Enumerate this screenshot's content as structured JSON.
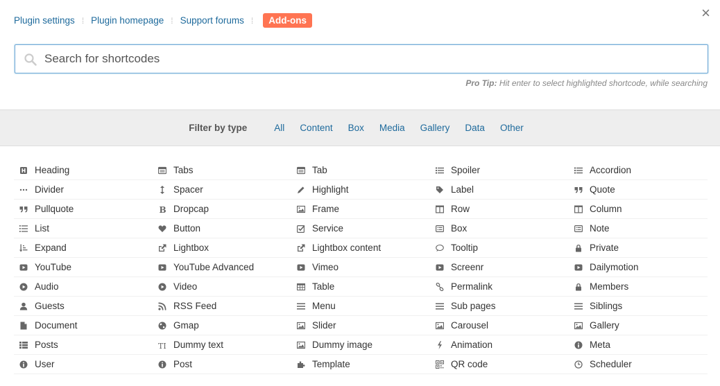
{
  "header": {
    "links": [
      "Plugin settings",
      "Plugin homepage",
      "Support forums"
    ],
    "addons_label": "Add-ons",
    "close_glyph": "×"
  },
  "search": {
    "placeholder": "Search for shortcodes",
    "value": ""
  },
  "protip": {
    "label": "Pro Tip:",
    "text": " Hit enter to select highlighted shortcode, while searching"
  },
  "filter": {
    "label": "Filter by type",
    "types": [
      "All",
      "Content",
      "Box",
      "Media",
      "Gallery",
      "Data",
      "Other"
    ]
  },
  "shortcodes": [
    {
      "label": "Heading",
      "icon": "heading-icon"
    },
    {
      "label": "Tabs",
      "icon": "tabs-icon"
    },
    {
      "label": "Tab",
      "icon": "tab-icon"
    },
    {
      "label": "Spoiler",
      "icon": "list-icon"
    },
    {
      "label": "Accordion",
      "icon": "list-icon"
    },
    {
      "label": "Divider",
      "icon": "ellipsis-icon"
    },
    {
      "label": "Spacer",
      "icon": "arrows-v-icon"
    },
    {
      "label": "Highlight",
      "icon": "pencil-icon"
    },
    {
      "label": "Label",
      "icon": "tag-icon"
    },
    {
      "label": "Quote",
      "icon": "quote-icon"
    },
    {
      "label": "Pullquote",
      "icon": "quote-icon"
    },
    {
      "label": "Dropcap",
      "icon": "bold-icon"
    },
    {
      "label": "Frame",
      "icon": "image-icon"
    },
    {
      "label": "Row",
      "icon": "columns-icon"
    },
    {
      "label": "Column",
      "icon": "columns-icon"
    },
    {
      "label": "List",
      "icon": "list-ol-icon"
    },
    {
      "label": "Button",
      "icon": "heart-icon"
    },
    {
      "label": "Service",
      "icon": "check-square-icon"
    },
    {
      "label": "Box",
      "icon": "list-alt-icon"
    },
    {
      "label": "Note",
      "icon": "list-alt-icon"
    },
    {
      "label": "Expand",
      "icon": "sort-icon"
    },
    {
      "label": "Lightbox",
      "icon": "external-link-icon"
    },
    {
      "label": "Lightbox content",
      "icon": "external-link-icon"
    },
    {
      "label": "Tooltip",
      "icon": "comment-icon"
    },
    {
      "label": "Private",
      "icon": "lock-icon"
    },
    {
      "label": "YouTube",
      "icon": "play-square-icon"
    },
    {
      "label": "YouTube Advanced",
      "icon": "play-square-icon"
    },
    {
      "label": "Vimeo",
      "icon": "play-square-icon"
    },
    {
      "label": "Screenr",
      "icon": "play-square-icon"
    },
    {
      "label": "Dailymotion",
      "icon": "play-square-icon"
    },
    {
      "label": "Audio",
      "icon": "play-circle-icon"
    },
    {
      "label": "Video",
      "icon": "play-circle-icon"
    },
    {
      "label": "Table",
      "icon": "table-icon"
    },
    {
      "label": "Permalink",
      "icon": "link-icon"
    },
    {
      "label": "Members",
      "icon": "lock-icon"
    },
    {
      "label": "Guests",
      "icon": "user-icon"
    },
    {
      "label": "RSS Feed",
      "icon": "rss-icon"
    },
    {
      "label": "Menu",
      "icon": "bars-icon"
    },
    {
      "label": "Sub pages",
      "icon": "bars-icon"
    },
    {
      "label": "Siblings",
      "icon": "bars-icon"
    },
    {
      "label": "Document",
      "icon": "file-icon"
    },
    {
      "label": "Gmap",
      "icon": "globe-icon"
    },
    {
      "label": "Slider",
      "icon": "image-icon"
    },
    {
      "label": "Carousel",
      "icon": "image-icon"
    },
    {
      "label": "Gallery",
      "icon": "image-icon"
    },
    {
      "label": "Posts",
      "icon": "th-list-icon"
    },
    {
      "label": "Dummy text",
      "icon": "text-height-icon"
    },
    {
      "label": "Dummy image",
      "icon": "image-icon"
    },
    {
      "label": "Animation",
      "icon": "bolt-icon"
    },
    {
      "label": "Meta",
      "icon": "info-circle-icon"
    },
    {
      "label": "User",
      "icon": "info-circle-icon"
    },
    {
      "label": "Post",
      "icon": "info-circle-icon"
    },
    {
      "label": "Template",
      "icon": "puzzle-icon"
    },
    {
      "label": "QR code",
      "icon": "qrcode-icon"
    },
    {
      "label": "Scheduler",
      "icon": "clock-icon"
    }
  ]
}
